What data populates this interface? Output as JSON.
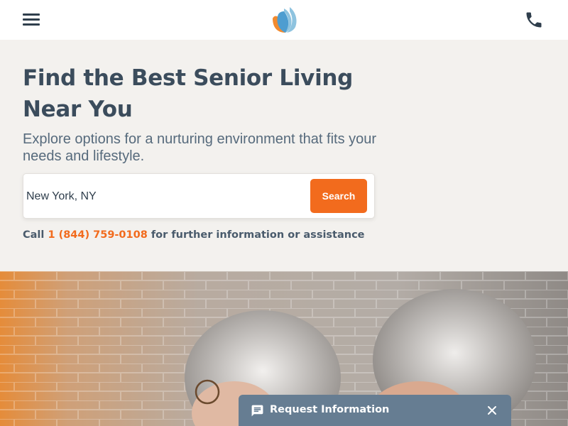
{
  "header": {
    "menu_icon": "hamburger-menu-icon",
    "logo_icon": "leaf-logo-icon",
    "phone_icon": "phone-icon"
  },
  "hero": {
    "title": "Find the Best Senior Living Near You",
    "subtitle": "Explore options for a nurturing environment that fits your needs and lifestyle.",
    "search": {
      "value": "New York, NY",
      "button_label": "Search"
    },
    "call": {
      "prefix": "Call",
      "phone": "1 (844) 759-0108",
      "suffix": "for further information or assistance"
    }
  },
  "request_bar": {
    "label": "Request Information",
    "icon": "chat-icon",
    "close_icon": "close-icon"
  },
  "colors": {
    "accent": "#f26b1d",
    "heading": "#3b4c5c",
    "background": "#f3f1ee",
    "request_bar": "#667d92",
    "logo_orange": "#f28a2e",
    "logo_blue": "#8ec3df"
  }
}
